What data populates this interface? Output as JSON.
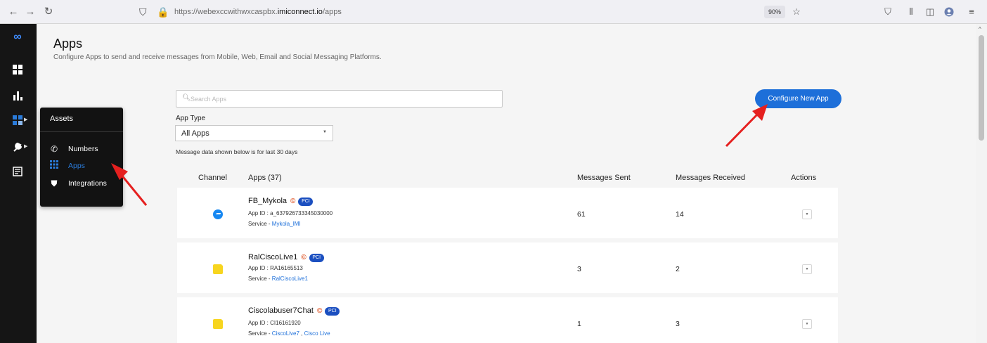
{
  "browser": {
    "url_prefix": "https://webexccwithwxcaspbx.",
    "url_host": "imiconnect.io",
    "url_path": "/apps",
    "zoom": "90%"
  },
  "icons": {
    "back": "arrow-left-icon",
    "forward": "arrow-right-icon",
    "reload": "reload-icon",
    "shield": "shield-icon",
    "lock": "lock-icon",
    "star": "star-icon",
    "pocket": "pocket-icon",
    "library": "library-icon",
    "sidebar": "sidebar-icon",
    "profile": "profile-icon",
    "menu": "hamburger-menu-icon"
  },
  "rail": {
    "items": [
      {
        "name": "webex-logo",
        "glyph": "∞"
      },
      {
        "name": "dashboard",
        "glyph": "▦"
      },
      {
        "name": "analytics",
        "glyph": "ılı"
      },
      {
        "name": "assets",
        "glyph": "▚"
      },
      {
        "name": "tools",
        "glyph": "🔧"
      },
      {
        "name": "logs",
        "glyph": "☷"
      }
    ]
  },
  "flyout": {
    "title": "Assets",
    "items": [
      {
        "label": "Numbers",
        "icon": "phone-icon"
      },
      {
        "label": "Apps",
        "icon": "grid-icon",
        "active": true
      },
      {
        "label": "Integrations",
        "icon": "plug-icon"
      }
    ]
  },
  "page": {
    "title": "Apps",
    "subtitle": "Configure Apps to send and receive messages from Mobile, Web, Email and Social Messaging Platforms.",
    "search_placeholder": "Search Apps",
    "configure_button": "Configure New App",
    "app_type_label": "App Type",
    "app_type_value": "All Apps",
    "note": "Message data shown below is for last 30 days"
  },
  "table": {
    "headers": {
      "channel": "Channel",
      "apps": "Apps (37)",
      "sent": "Messages Sent",
      "received": "Messages Received",
      "actions": "Actions"
    },
    "rows": [
      {
        "channel": "messenger",
        "name": "FB_Mykola",
        "badge_c": "©",
        "badge_pci": "PCI",
        "app_id": "App ID : a_637926733345030000",
        "service_prefix": "Service - ",
        "services": [
          "Mykola_IMI"
        ],
        "sent": "61",
        "received": "14"
      },
      {
        "channel": "chat",
        "name": "RalCiscoLive1",
        "badge_c": "©",
        "badge_pci": "PCI",
        "app_id": "App ID : RA16165513",
        "service_prefix": "Service - ",
        "services": [
          "RalCiscoLive1"
        ],
        "sent": "3",
        "received": "2"
      },
      {
        "channel": "chat",
        "name": "Ciscolabuser7Chat",
        "badge_c": "©",
        "badge_pci": "PCI",
        "app_id": "App ID : CI16161920",
        "service_prefix": "Service - ",
        "services": [
          "CiscoLive7",
          "Cisco Live"
        ],
        "sent": "1",
        "received": "3"
      }
    ]
  },
  "colors": {
    "accent": "#1d6fd9",
    "rail": "#151515",
    "annotation_arrow": "#e5201f"
  }
}
